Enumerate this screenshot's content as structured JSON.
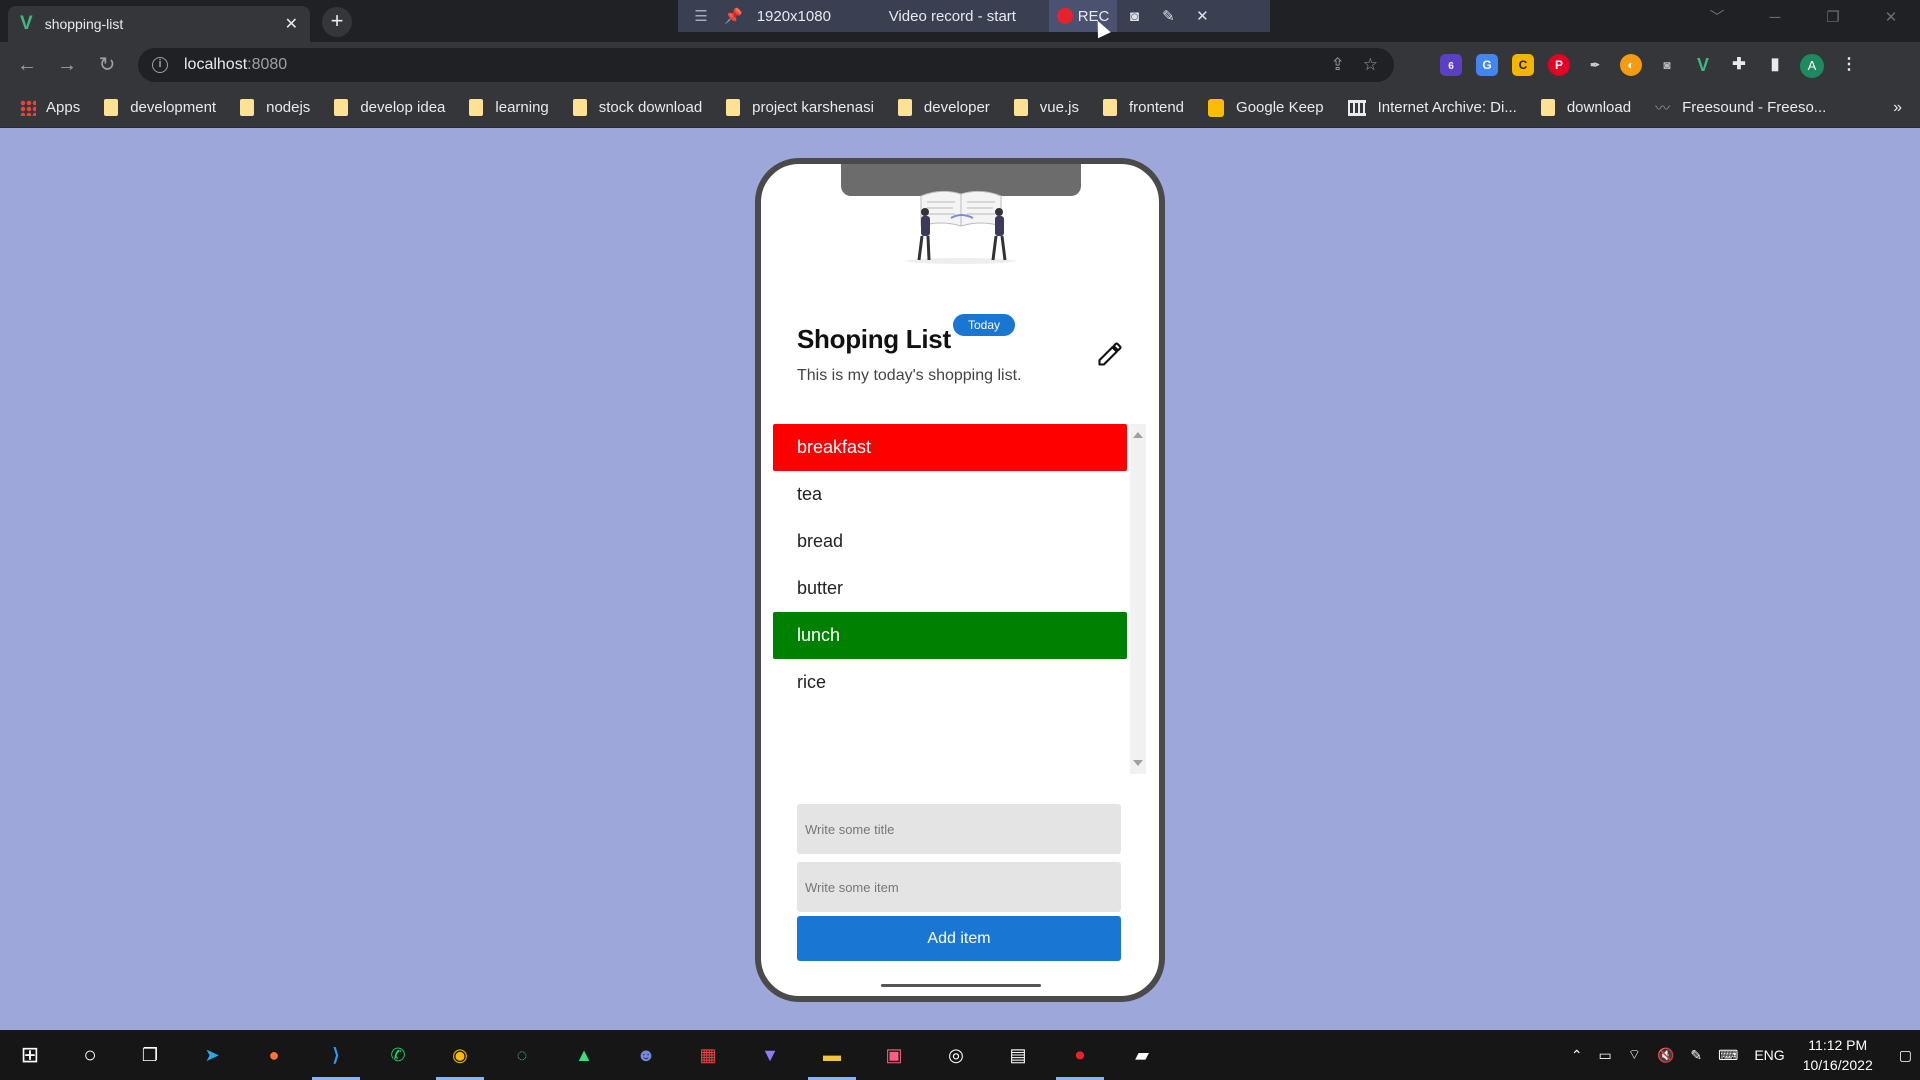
{
  "browser": {
    "tab_title": "shopping-list",
    "new_tab": "+",
    "close_tab": "✕",
    "url_host": "localhost",
    "url_port": ":8080",
    "window_controls": [
      "﹀",
      "─",
      "❐",
      "✕"
    ]
  },
  "recorder": {
    "menu": "☰",
    "resolution": "1920x1080",
    "status": "Video record - start",
    "rec_label": "REC",
    "close": "✕"
  },
  "bookmarks": [
    {
      "label": "Apps",
      "icon": "apps-grid-icon"
    },
    {
      "label": "development",
      "icon": "folder-icon"
    },
    {
      "label": "nodejs",
      "icon": "folder-icon"
    },
    {
      "label": "develop idea",
      "icon": "folder-icon"
    },
    {
      "label": "learning",
      "icon": "folder-icon"
    },
    {
      "label": "stock download",
      "icon": "folder-icon"
    },
    {
      "label": "project karshenasi",
      "icon": "folder-icon"
    },
    {
      "label": "developer",
      "icon": "folder-icon"
    },
    {
      "label": "vue.js",
      "icon": "folder-icon"
    },
    {
      "label": "frontend",
      "icon": "folder-icon"
    },
    {
      "label": "Google Keep",
      "icon": "keep-icon"
    },
    {
      "label": "Internet Archive: Di...",
      "icon": "archive-icon"
    },
    {
      "label": "download",
      "icon": "folder-icon"
    },
    {
      "label": "Freesound - Freeso...",
      "icon": "freesound-icon"
    }
  ],
  "bookmarks_more": "»",
  "extensions": {
    "badge_count": "6",
    "avatar_letter": "A"
  },
  "app": {
    "title": "Shoping List",
    "badge": "Today",
    "subtitle": "This is my today's shopping list.",
    "items": [
      {
        "label": "breakfast",
        "type": "category",
        "color": "#ff0000"
      },
      {
        "label": "tea",
        "type": "item"
      },
      {
        "label": "bread",
        "type": "item"
      },
      {
        "label": "butter",
        "type": "item"
      },
      {
        "label": "lunch",
        "type": "category",
        "color": "#008000"
      },
      {
        "label": "rice",
        "type": "item"
      }
    ],
    "title_placeholder": "Write some title",
    "item_placeholder": "Write some item",
    "add_button": "Add item",
    "accent": "#1976d2"
  },
  "taskbar": {
    "language": "ENG",
    "time": "11:12 PM",
    "date": "10/16/2022"
  }
}
